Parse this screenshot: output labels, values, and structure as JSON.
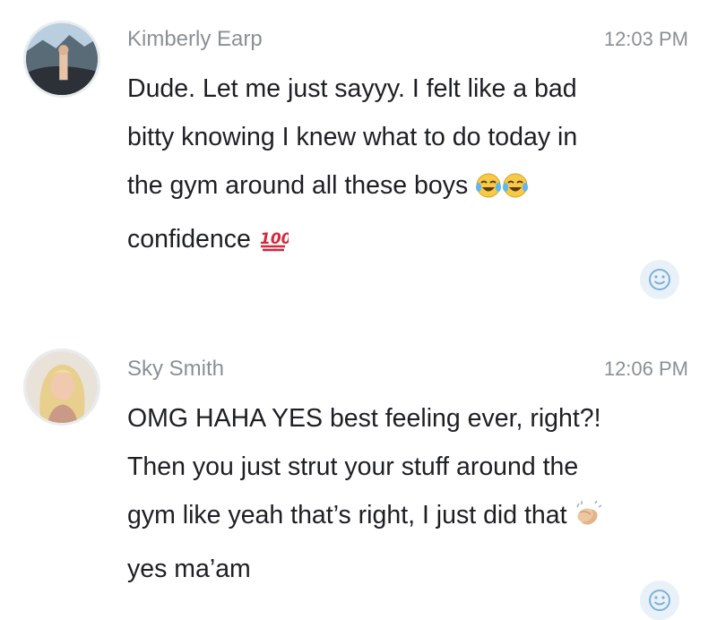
{
  "messages": [
    {
      "sender": "Kimberly Earp",
      "time": "12:03 PM",
      "lines": [
        "Dude. Let me just sayyy. I felt like a bad",
        "bitty knowing I knew what to do today in",
        "the gym around all these boys",
        "confidence"
      ],
      "emojis": [
        "face-with-tears-of-joy-icon",
        "face-with-tears-of-joy-icon",
        "hundred-points-icon"
      ]
    },
    {
      "sender": "Sky Smith",
      "time": "12:06 PM",
      "lines": [
        "OMG HAHA YES best feeling ever, right?!",
        "Then you just strut your stuff around the",
        "gym like yeah that’s right, I just did that",
        "yes ma’am"
      ],
      "emojis": [
        "clapping-hands-icon"
      ]
    }
  ],
  "colors": {
    "meta_text": "#8a8f98",
    "body_text": "#1d1f24",
    "reaction_bg": "#e8f1f8",
    "reaction_icon": "#7fb0d9"
  }
}
